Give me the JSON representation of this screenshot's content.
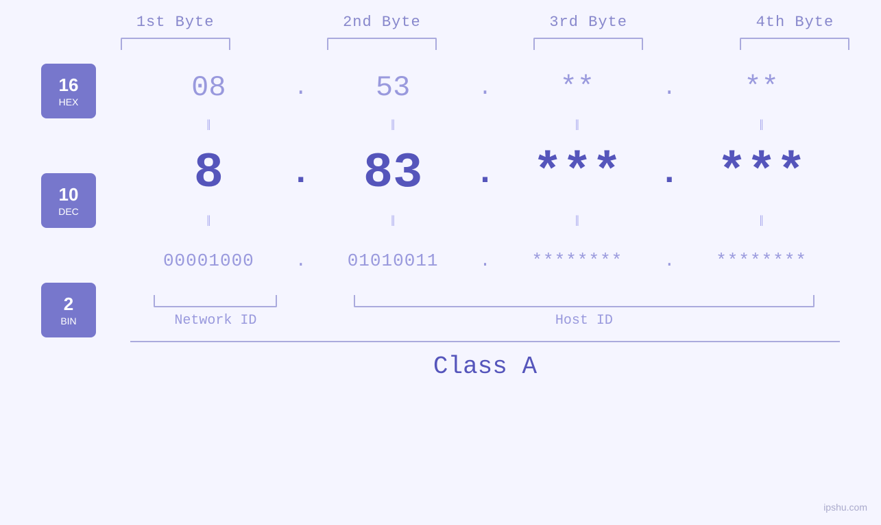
{
  "header": {
    "byte1": "1st Byte",
    "byte2": "2nd Byte",
    "byte3": "3rd Byte",
    "byte4": "4th Byte"
  },
  "badges": [
    {
      "number": "16",
      "label": "HEX"
    },
    {
      "number": "10",
      "label": "DEC"
    },
    {
      "number": "2",
      "label": "BIN"
    }
  ],
  "hex": {
    "b1": "08",
    "b2": "53",
    "b3": "**",
    "b4": "**",
    "dot": "."
  },
  "dec": {
    "b1": "8",
    "b2": "83",
    "b3": "***",
    "b4": "***",
    "dot": "."
  },
  "bin": {
    "b1": "00001000",
    "b2": "01010011",
    "b3": "********",
    "b4": "********",
    "dot": "."
  },
  "labels": {
    "network_id": "Network ID",
    "host_id": "Host ID",
    "class": "Class A"
  },
  "watermark": "ipshu.com"
}
